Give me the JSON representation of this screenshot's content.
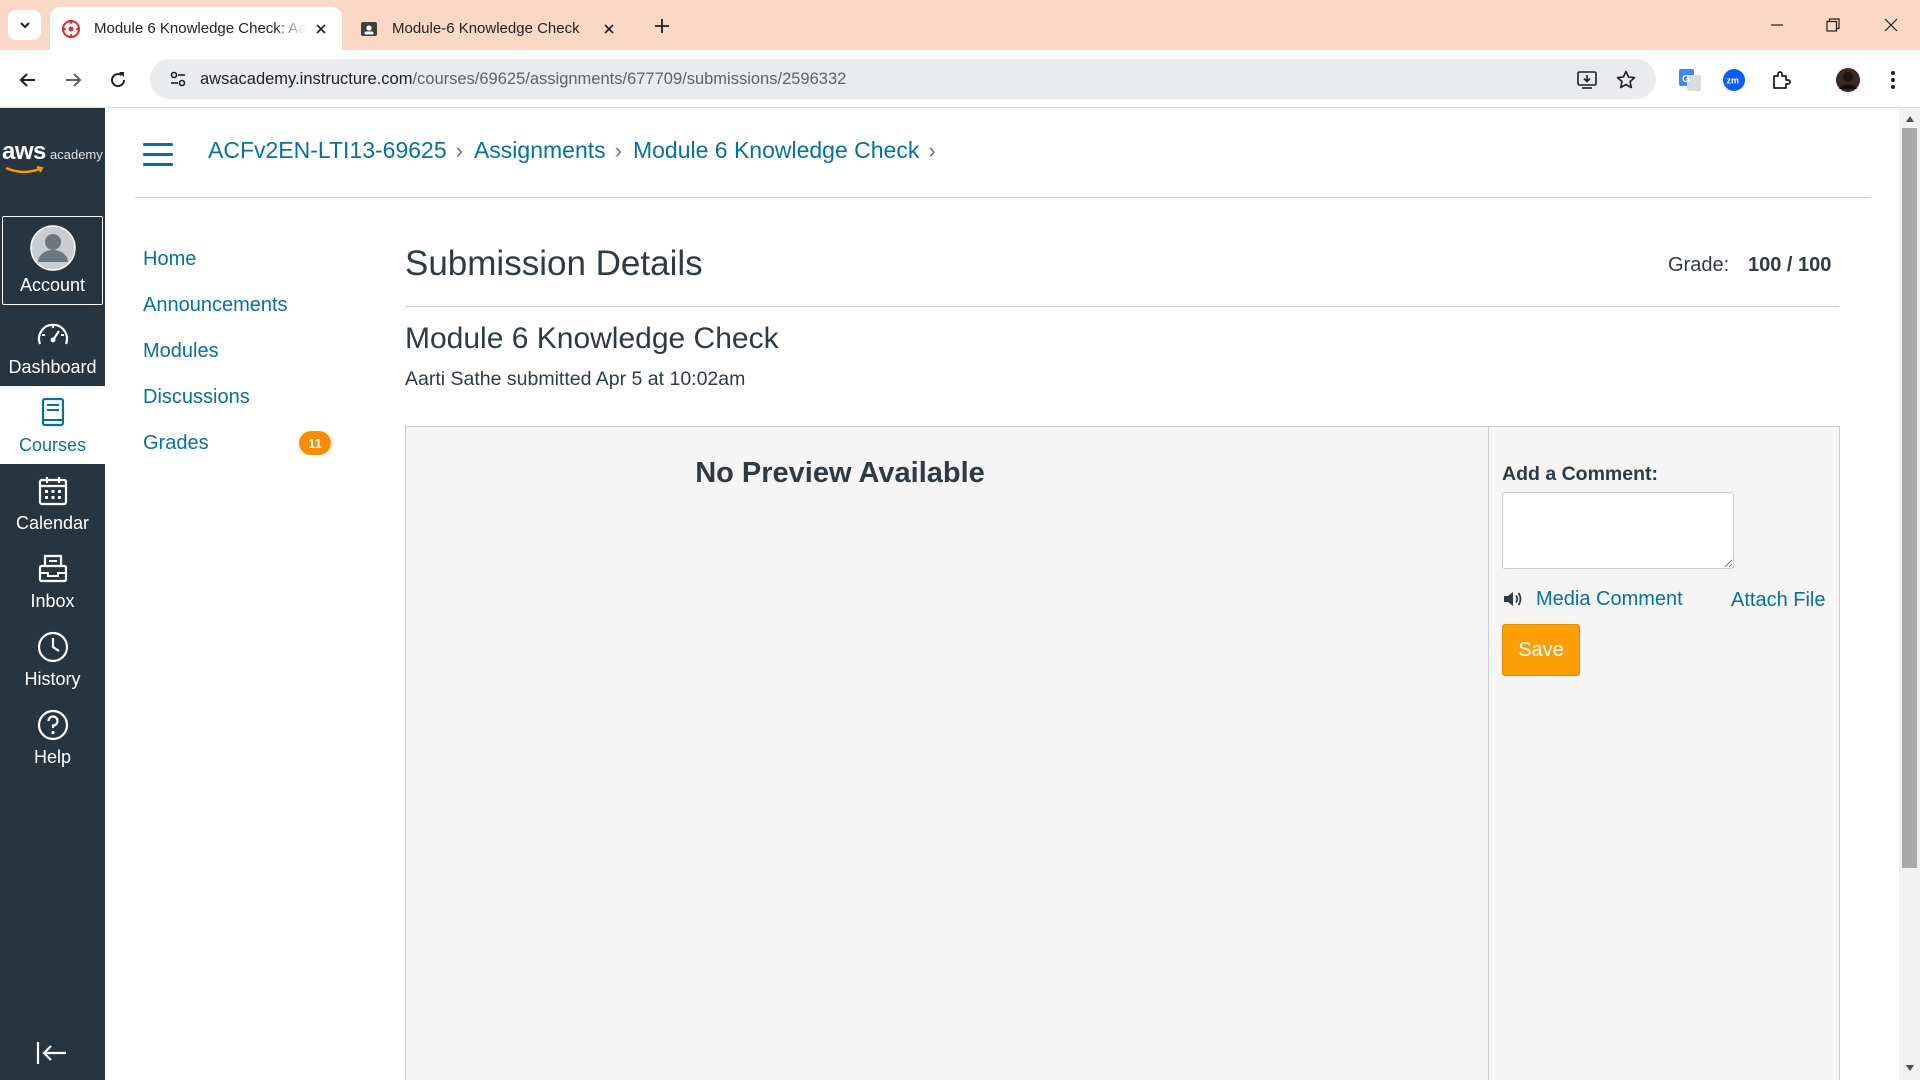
{
  "browser": {
    "tabs": [
      {
        "title": "Module 6 Knowledge Check: Aa",
        "active": true
      },
      {
        "title": "Module-6 Knowledge Check",
        "active": false
      }
    ],
    "url_host": "awsacademy.instructure.com",
    "url_path": "/courses/69625/assignments/677709/submissions/2596332"
  },
  "global_nav": {
    "logo_text": "aws",
    "logo_subtext": "academy",
    "items": [
      {
        "label": "Account",
        "icon": "account-avatar-icon"
      },
      {
        "label": "Dashboard",
        "icon": "dashboard-gauge-icon"
      },
      {
        "label": "Courses",
        "icon": "courses-book-icon",
        "selected": true
      },
      {
        "label": "Calendar",
        "icon": "calendar-icon"
      },
      {
        "label": "Inbox",
        "icon": "inbox-icon"
      },
      {
        "label": "History",
        "icon": "history-clock-icon"
      },
      {
        "label": "Help",
        "icon": "help-question-icon"
      }
    ]
  },
  "breadcrumb": [
    "ACFv2EN-LTI13-69625",
    "Assignments",
    "Module 6 Knowledge Check"
  ],
  "course_nav": {
    "items": [
      "Home",
      "Announcements",
      "Modules",
      "Discussions",
      "Grades"
    ],
    "grades_badge": "11"
  },
  "submission": {
    "page_title": "Submission Details",
    "grade_label": "Grade:",
    "grade_value": "100 / 100",
    "assignment_title": "Module 6 Knowledge Check",
    "submitted_line": "Aarti Sathe submitted Apr 5 at 10:02am",
    "preview_text": "No Preview Available"
  },
  "comment": {
    "label": "Add a Comment:",
    "value": "",
    "media_comment": "Media Comment",
    "attach_file": "Attach File",
    "save": "Save"
  },
  "colors": {
    "link": "#0770a3",
    "nav_bg": "#273540",
    "save_button": "#fc9e07",
    "badge": "#ff8c00",
    "tab_strip": "#f9d9c6"
  }
}
